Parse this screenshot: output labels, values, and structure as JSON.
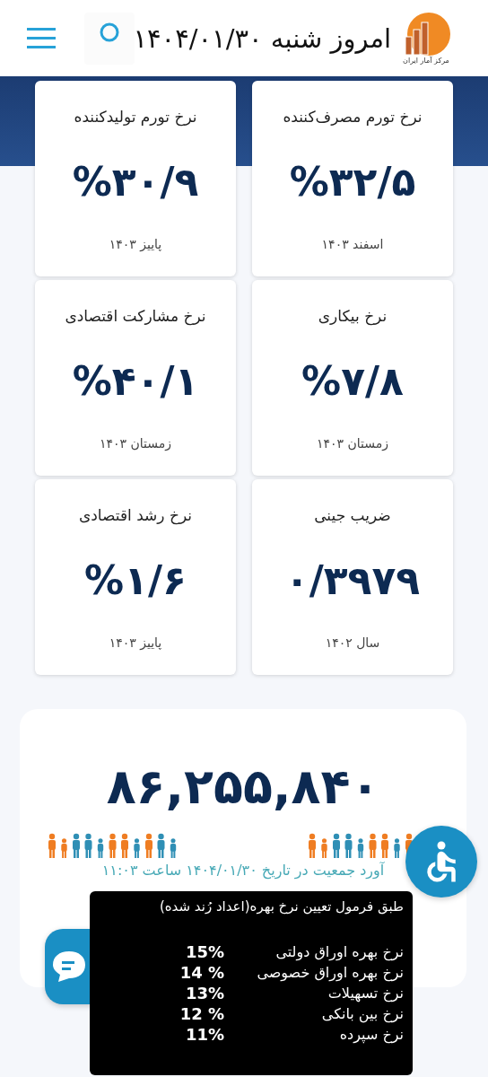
{
  "header": {
    "logo_text": "مرکز آمار ایران",
    "title": "امروز شنبه ۱۴۰۴/۰۱/۳۰"
  },
  "stats": [
    {
      "title": "نرخ تورم مصرف‌کننده",
      "value": "%۳۲/۵",
      "period": "اسفند ۱۴۰۳"
    },
    {
      "title": "نرخ تورم تولیدکننده",
      "value": "%۳۰/۹",
      "period": "پاییز ۱۴۰۳"
    },
    {
      "title": "نرخ بیکاری",
      "value": "%۷/۸",
      "period": "زمستان ۱۴۰۳"
    },
    {
      "title": "نرخ مشارکت اقتصادی",
      "value": "%۴۰/۱",
      "period": "زمستان ۱۴۰۳"
    },
    {
      "title": "ضریب جینی",
      "value": "۰/۳۹۷۹",
      "period": "سال ۱۴۰۲"
    },
    {
      "title": "نرخ رشد اقتصادی",
      "value": "%۱/۶",
      "period": "پاییز ۱۴۰۳"
    }
  ],
  "population": {
    "value": "۸۶,۲۵۵,۸۴۰",
    "caption": "آورد جمعیت در تاریخ ۱۴۰۴/۰۱/۳۰ ساعت ۱۱:۰۳"
  },
  "interest_popup": {
    "heading": "طبق فرمول تعیین نرخ بهره(اعداد رُند شده)",
    "rates": [
      {
        "label": "نرخ بهره اوراق دولتی",
        "value": "15%"
      },
      {
        "label": "نرخ بهره اوراق خصوصی",
        "value": "14 %"
      },
      {
        "label": "نرخ تسهیلات",
        "value": "13%"
      },
      {
        "label": "نرخ بین بانکی",
        "value": "12 %"
      },
      {
        "label": "نرخ سپرده",
        "value": "11%"
      }
    ]
  }
}
